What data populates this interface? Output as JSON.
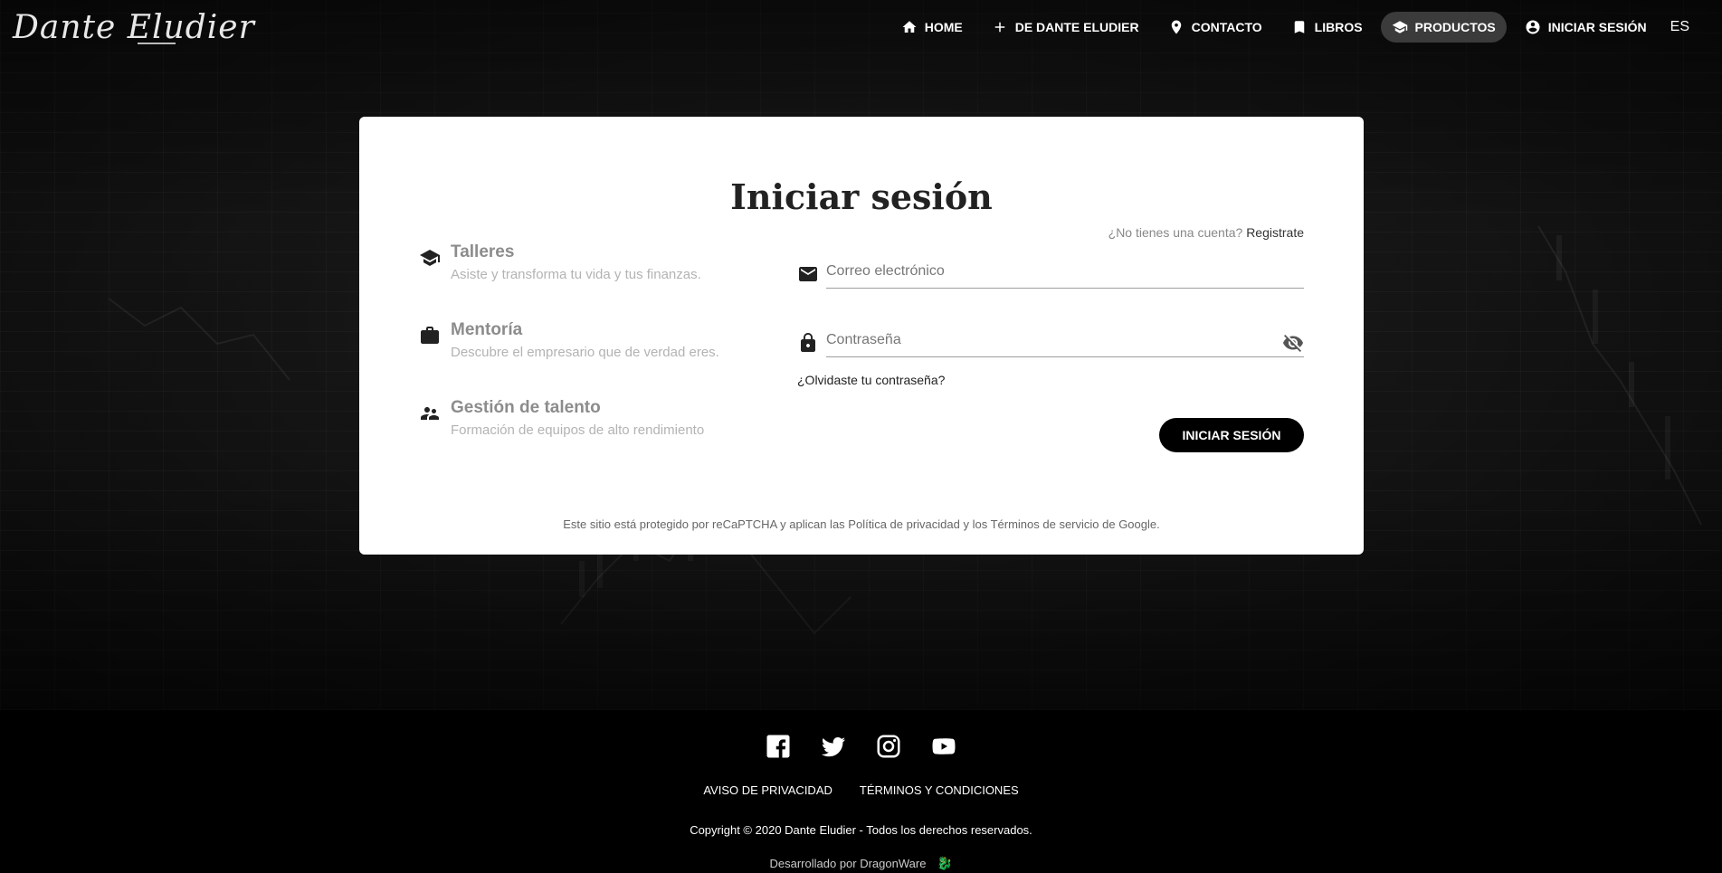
{
  "header": {
    "logo_text": "Dante Eludier",
    "nav": [
      {
        "label": "HOME",
        "icon": "home-icon"
      },
      {
        "label": "DE DANTE ELUDIER",
        "icon": "plus-icon"
      },
      {
        "label": "CONTACTO",
        "icon": "location-pin-icon"
      },
      {
        "label": "LIBROS",
        "icon": "bookmark-icon"
      },
      {
        "label": "PRODUCTOS",
        "icon": "graduation-cap-icon",
        "active": true
      },
      {
        "label": "INICIAR SESIÓN",
        "icon": "account-circle-icon"
      }
    ],
    "language": "ES"
  },
  "login": {
    "title": "Iniciar sesión",
    "features": [
      {
        "title": "Talleres",
        "desc": "Asiste y transforma tu vida y tus finanzas.",
        "icon": "graduation-cap-icon"
      },
      {
        "title": "Mentoría",
        "desc": "Descubre el empresario que de verdad eres.",
        "icon": "briefcase-icon"
      },
      {
        "title": "Gestión de talento",
        "desc": "Formación de equipos de alto rendimiento",
        "icon": "people-icon"
      }
    ],
    "signup_prompt": "¿No tienes una cuenta?",
    "signup_link": "Registrate",
    "email_placeholder": "Correo electrónico",
    "password_placeholder": "Contraseña",
    "forgot_password": "¿Olvidaste tu contraseña?",
    "submit_label": "INICIAR SESIÓN",
    "recaptcha_notice": "Este sitio está protegido por reCaPTCHA y aplican las Política de privacidad y los Términos de servicio de Google."
  },
  "footer": {
    "socials": [
      "facebook-icon",
      "twitter-icon",
      "instagram-icon",
      "youtube-icon"
    ],
    "links": [
      "AVISO DE PRIVACIDAD",
      "TÉRMINOS Y CONDICIONES"
    ],
    "copyright": "Copyright © 2020 Dante Eludier - Todos los derechos reservados.",
    "developer": "Desarrollado por DragonWare"
  },
  "colors": {
    "accent": "#000000",
    "card_bg": "#ffffff",
    "nav_active_bg": "#3b3b3b"
  }
}
